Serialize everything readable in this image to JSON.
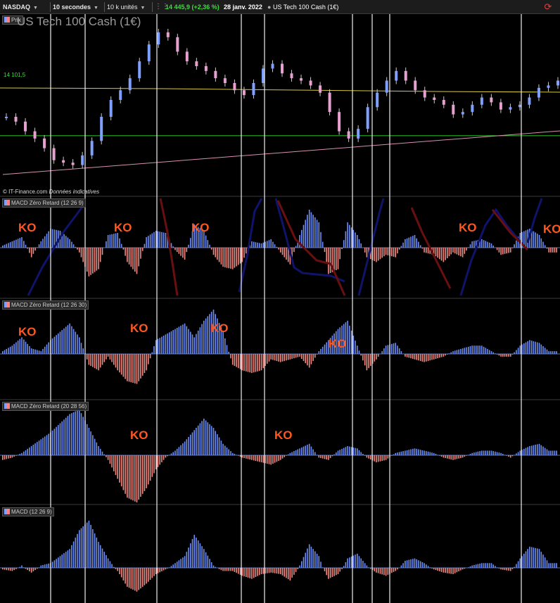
{
  "toolbar": {
    "symbol": "NASDAQ",
    "period": "10 secondes",
    "units": "10 k unités",
    "price": "14 445,9 (+2,36 %)",
    "date": "28 janv. 2022",
    "instrument": "US Tech 100 Cash (1€)"
  },
  "price_panel": {
    "tag": "Prix",
    "title": "US Tech 100 Cash (1€)",
    "level_label": "14 101,5",
    "copyright_source": "© IT-Finance.com",
    "copyright_note": "Données indicatives"
  },
  "panels": [
    {
      "title": "MACD Zéro Retard (12 26 9)",
      "ko": [
        "KO",
        "KO",
        "KO",
        "KO",
        "KO"
      ]
    },
    {
      "title": "MACD Zéro Retard (12 26 30)",
      "ko": [
        "KO",
        "KO",
        "KO",
        "KO"
      ]
    },
    {
      "title": "MACD Zéro Retard (20 28 56)",
      "ko": [
        "KO",
        "KO"
      ]
    },
    {
      "title": "MACD (12 26 9)",
      "ko": []
    }
  ],
  "colors": {
    "positive_histogram": "#6d8ff5",
    "negative_histogram": "#f08a82",
    "green_level": "#2ecc2e",
    "yellow_level": "#d8c840",
    "trendline": "#d88fb0",
    "ko_text": "#ff5722",
    "background": "#000000"
  },
  "chart_data": [
    {
      "type": "line",
      "title": "US Tech 100 Cash (1€)",
      "series": [
        {
          "values": [
            14180,
            14160,
            14120,
            14090,
            14050,
            14000,
            13990,
            13980,
            14020,
            14080,
            14180,
            14250,
            14290,
            14340,
            14410,
            14480,
            14530,
            14510,
            14450,
            14410,
            14390,
            14370,
            14340,
            14320,
            14290,
            14270,
            14320,
            14380,
            14400,
            14360,
            14340,
            14330,
            14310,
            14280,
            14200,
            14120,
            14090,
            14130,
            14220,
            14280,
            14330,
            14370,
            14330,
            14290,
            14260,
            14250,
            14230,
            14190,
            14200,
            14230,
            14260,
            14240,
            14210,
            14220,
            14230,
            14260,
            14300,
            14310,
            14330
          ]
        }
      ],
      "annotations": [
        {
          "label": "14 101,5",
          "value": 14101.5
        }
      ]
    },
    {
      "type": "bar",
      "title": "MACD Zéro Retard (12 26 9)",
      "series": [
        {
          "values": [
            0.05,
            0.15,
            0.25,
            -0.2,
            0.15,
            0.45,
            0.4,
            0.2,
            -0.1,
            -0.6,
            -0.45,
            0.3,
            0.35,
            -0.3,
            -0.55,
            0.25,
            0.4,
            0.35,
            -0.05,
            -0.25,
            0.55,
            0.4,
            -0.15,
            -0.4,
            -0.45,
            -0.3,
            0.15,
            0.1,
            0.2,
            -0.1,
            -0.35,
            0.3,
            0.9,
            0.6,
            -0.55,
            -0.45,
            0.6,
            0.3,
            -0.2,
            -0.3,
            -0.15,
            -0.2,
            0.2,
            0.3,
            -0.1,
            -0.15,
            -0.3,
            -0.1,
            -0.2,
            0.15,
            0.2,
            0.1,
            -0.15,
            -0.1,
            0.35,
            0.45,
            0.3,
            -0.1
          ]
        }
      ]
    },
    {
      "type": "bar",
      "title": "MACD Zéro Retard (12 26 30)",
      "series": [
        {
          "values": [
            0.05,
            0.15,
            0.3,
            0.1,
            0.05,
            0.25,
            0.4,
            0.55,
            0.3,
            -0.2,
            -0.3,
            -0.05,
            -0.3,
            -0.5,
            -0.55,
            -0.3,
            0.25,
            0.35,
            0.45,
            0.55,
            0.3,
            0.6,
            0.8,
            0.4,
            -0.2,
            -0.3,
            -0.35,
            -0.3,
            -0.1,
            -0.15,
            -0.1,
            -0.05,
            -0.25,
            0.05,
            0.25,
            0.45,
            0.6,
            0.15,
            -0.3,
            -0.1,
            0.15,
            0.2,
            -0.05,
            -0.1,
            -0.15,
            -0.1,
            -0.05,
            0.05,
            0.1,
            0.15,
            0.15,
            0.05,
            -0.05,
            -0.05,
            0.15,
            0.25,
            0.2,
            0.05
          ]
        }
      ]
    },
    {
      "type": "bar",
      "title": "MACD Zéro Retard (20 28 56)",
      "series": [
        {
          "values": [
            -0.1,
            -0.05,
            0.05,
            0.2,
            0.35,
            0.5,
            0.7,
            0.9,
            1.0,
            0.6,
            0.2,
            -0.1,
            -0.5,
            -0.9,
            -1.0,
            -0.7,
            -0.3,
            -0.05,
            0.1,
            0.3,
            0.55,
            0.8,
            0.6,
            0.25,
            0.05,
            -0.05,
            -0.1,
            -0.15,
            -0.2,
            -0.1,
            0.05,
            0.15,
            0.25,
            -0.05,
            -0.1,
            0.1,
            0.2,
            0.15,
            -0.05,
            -0.15,
            -0.1,
            0.05,
            0.1,
            0.15,
            0.1,
            0.05,
            -0.05,
            -0.1,
            -0.05,
            0.05,
            0.1,
            0.1,
            0.05,
            -0.05,
            0.1,
            0.2,
            0.25,
            0.1
          ]
        }
      ]
    },
    {
      "type": "bar",
      "title": "MACD (12 26 9)",
      "series": [
        {
          "values": [
            -0.05,
            -0.1,
            0.05,
            -0.15,
            0.05,
            0.1,
            0.25,
            0.4,
            0.8,
            1.0,
            0.55,
            0.2,
            -0.1,
            -0.6,
            -0.75,
            -0.5,
            -0.2,
            -0.05,
            0.1,
            0.25,
            0.7,
            0.4,
            0.05,
            -0.1,
            -0.1,
            -0.25,
            -0.35,
            -0.2,
            -0.15,
            -0.2,
            -0.4,
            0.05,
            0.5,
            0.25,
            -0.35,
            -0.2,
            0.2,
            0.3,
            0.05,
            -0.15,
            -0.25,
            -0.1,
            0.15,
            0.2,
            0.1,
            -0.05,
            -0.15,
            -0.2,
            -0.05,
            0.05,
            0.1,
            0.1,
            -0.05,
            -0.1,
            0.2,
            0.45,
            0.4,
            0.1
          ]
        }
      ]
    }
  ]
}
